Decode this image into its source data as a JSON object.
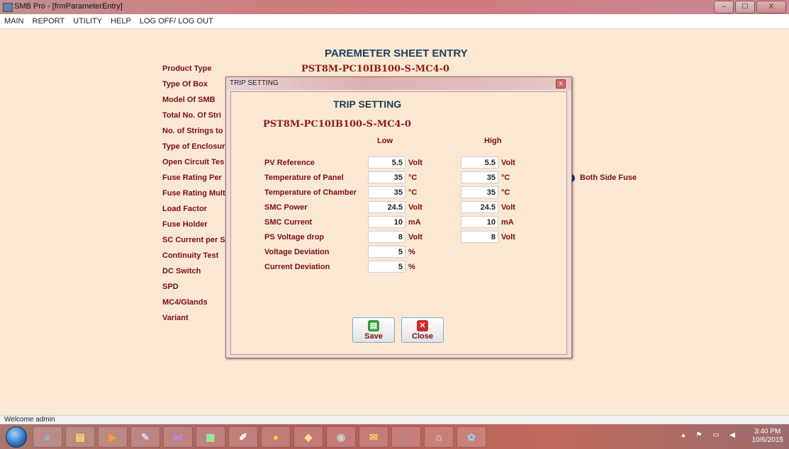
{
  "window": {
    "title": "SMB Pro - [frmParameterEntry]",
    "controls": [
      "–",
      "☐",
      "X"
    ]
  },
  "menu": [
    "MAIN",
    "REPORT",
    "UTILITY",
    "HELP",
    "LOG OFF/ LOG OUT"
  ],
  "main": {
    "heading": "PAREMETER SHEET ENTRY",
    "product_code": "PST8M-PC10IB100-S-MC4-0",
    "labels": [
      "Product Type",
      "Type Of Box",
      "Model Of SMB",
      "Total No. Of Stri",
      "No. of Strings to",
      "Type of Enclosur",
      "Open Circuit Tes",
      "Fuse Rating Per",
      "Fuse Rating Mult",
      "Load Factor",
      "Fuse Holder",
      "SC Current per S",
      "Continuity Test",
      "DC Switch",
      "SPD",
      "MC4/Glands",
      "Variant"
    ],
    "both_side_fuse": "Both Side Fuse"
  },
  "dialog": {
    "title_bar": "TRIP SETTING",
    "heading": "TRIP SETTING",
    "product_code": "PST8M-PC10IB100-S-MC4-0",
    "col_low": "Low",
    "col_high": "High",
    "rows": [
      {
        "label": "PV Reference",
        "low": "5.5",
        "low_unit": "Volt",
        "high": "5.5",
        "high_unit": "Volt"
      },
      {
        "label": "Temperature of Panel",
        "low": "35",
        "low_unit": "°C",
        "high": "35",
        "high_unit": "°C"
      },
      {
        "label": "Temperature of Chamber",
        "low": "35",
        "low_unit": "°C",
        "high": "35",
        "high_unit": "°C"
      },
      {
        "label": "SMC Power",
        "low": "24.5",
        "low_unit": "Volt",
        "high": "24.5",
        "high_unit": "Volt"
      },
      {
        "label": "SMC Current",
        "low": "10",
        "low_unit": "mA",
        "high": "10",
        "high_unit": "mA"
      },
      {
        "label": "PS Voltage drop",
        "low": "8",
        "low_unit": "Volt",
        "high": "8",
        "high_unit": "Volt"
      },
      {
        "label": "Voltage Deviation",
        "low": "5",
        "low_unit": "%"
      },
      {
        "label": "Current Deviation",
        "low": "5",
        "low_unit": "%"
      }
    ],
    "save_label": "Save",
    "close_label": "Close",
    "close_x": "x"
  },
  "status": {
    "text": "Welcome admin"
  },
  "taskbar": {
    "time": "3:40 PM",
    "date": "10/6/2015",
    "apps": [
      "internet-explorer-icon",
      "file-explorer-icon",
      "media-player-icon",
      "tools-icon",
      "visual-studio-icon",
      "excel-icon",
      "paint-icon",
      "chrome-icon",
      "folder-icon",
      "database-icon",
      "outlook-icon",
      "teamviewer-icon",
      "building-icon",
      "palette-icon"
    ]
  },
  "colors": {
    "background": "#fbe8d2",
    "label_text": "#7a0f0f",
    "heading_text": "#1e3f5a"
  }
}
